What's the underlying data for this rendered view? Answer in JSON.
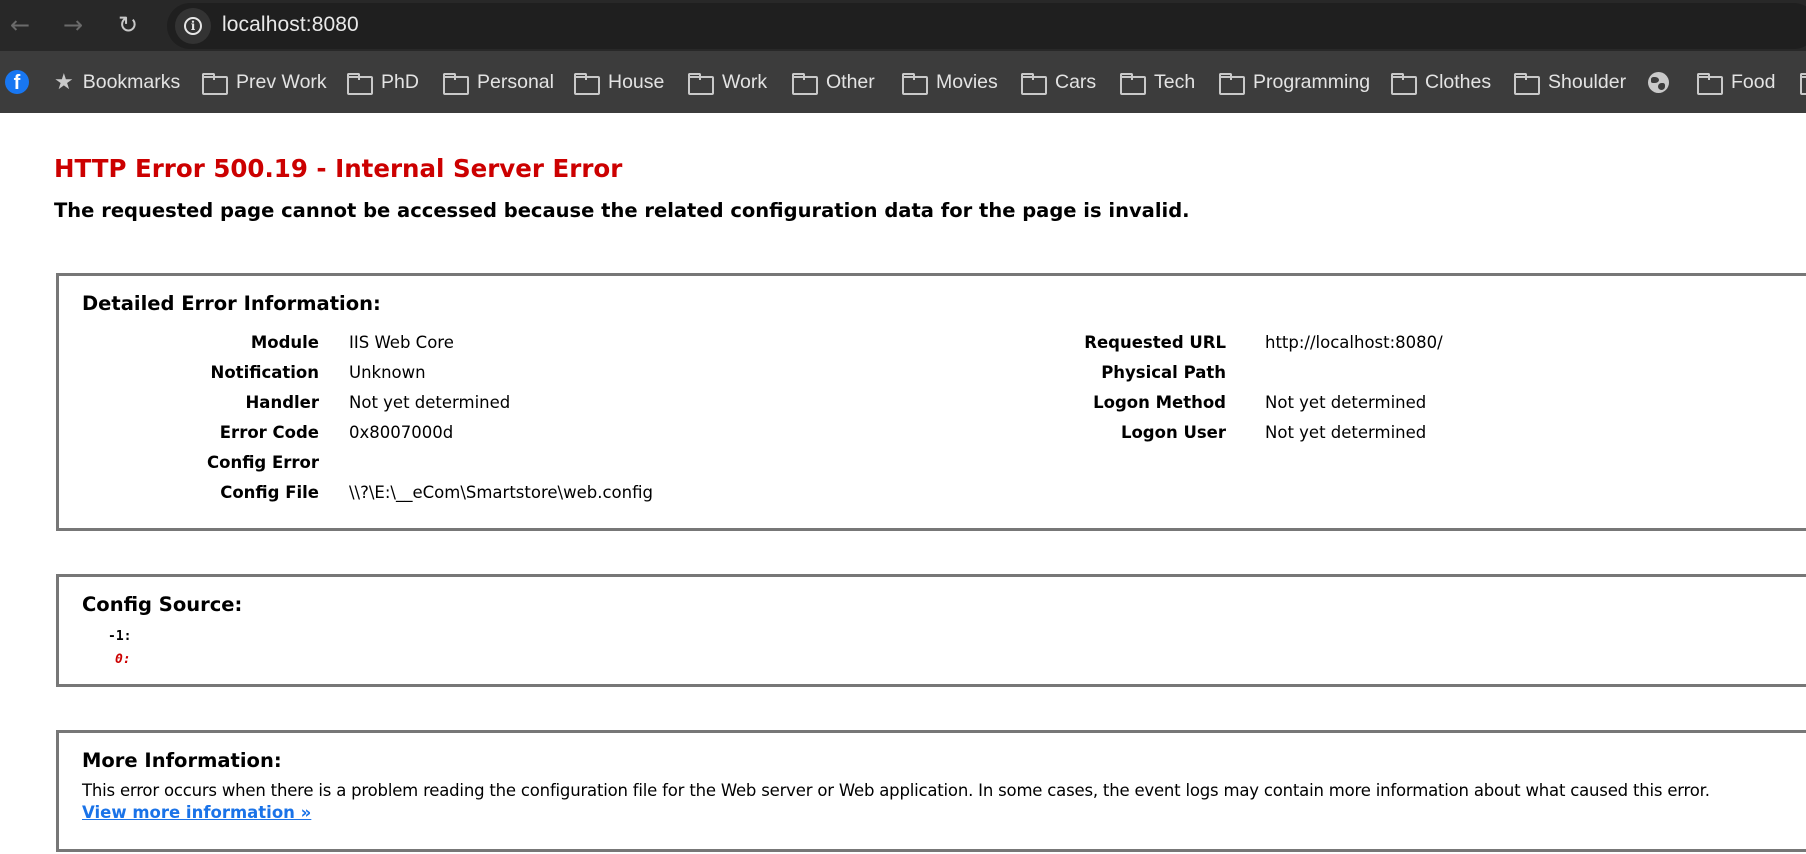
{
  "browser": {
    "url": "localhost:8080",
    "nav": {
      "back_icon": "arrow-left-icon",
      "forward_icon": "arrow-right-icon",
      "reload_icon": "reload-icon",
      "site_info_icon": "info-icon"
    },
    "bookmarks": [
      {
        "type": "site",
        "icon": "facebook-icon",
        "label": ""
      },
      {
        "type": "bookmarks",
        "icon": "star-icon",
        "label": "Bookmarks"
      },
      {
        "type": "folder",
        "icon": "folder-icon",
        "label": "Prev Work"
      },
      {
        "type": "folder",
        "icon": "folder-icon",
        "label": "PhD"
      },
      {
        "type": "folder",
        "icon": "folder-icon",
        "label": "Personal"
      },
      {
        "type": "folder",
        "icon": "folder-icon",
        "label": "House"
      },
      {
        "type": "folder",
        "icon": "folder-icon",
        "label": "Work"
      },
      {
        "type": "folder",
        "icon": "folder-icon",
        "label": "Other"
      },
      {
        "type": "folder",
        "icon": "folder-icon",
        "label": "Movies"
      },
      {
        "type": "folder",
        "icon": "folder-icon",
        "label": "Cars"
      },
      {
        "type": "folder",
        "icon": "folder-icon",
        "label": "Tech"
      },
      {
        "type": "folder",
        "icon": "folder-icon",
        "label": "Programming"
      },
      {
        "type": "folder",
        "icon": "folder-icon",
        "label": "Clothes"
      },
      {
        "type": "folder",
        "icon": "folder-icon",
        "label": "Shoulder"
      },
      {
        "type": "site",
        "icon": "globe-icon",
        "label": ""
      },
      {
        "type": "folder",
        "icon": "folder-icon",
        "label": "Food"
      },
      {
        "type": "folder",
        "icon": "folder-icon",
        "label": ""
      }
    ]
  },
  "page": {
    "title": "HTTP Error 500.19 - Internal Server Error",
    "subtitle": "The requested page cannot be accessed because the related configuration data for the page is invalid.",
    "detail": {
      "heading": "Detailed Error Information:",
      "left": [
        {
          "key": "Module",
          "value": "IIS Web Core"
        },
        {
          "key": "Notification",
          "value": "Unknown"
        },
        {
          "key": "Handler",
          "value": "Not yet determined"
        },
        {
          "key": "Error Code",
          "value": "0x8007000d"
        },
        {
          "key": "Config Error",
          "value": ""
        },
        {
          "key": "Config File",
          "value": "\\\\?\\E:\\__eCom\\Smartstore\\web.config"
        }
      ],
      "right": [
        {
          "key": "Requested URL",
          "value": "http://localhost:8080/"
        },
        {
          "key": "Physical Path",
          "value": ""
        },
        {
          "key": "Logon Method",
          "value": "Not yet determined"
        },
        {
          "key": "Logon User",
          "value": "Not yet determined"
        }
      ]
    },
    "config_source": {
      "heading": "Config Source:",
      "lines": [
        {
          "number": "-1:",
          "text": ""
        },
        {
          "number": "0:",
          "text": ""
        }
      ]
    },
    "more_info": {
      "heading": "More Information:",
      "text": "This error occurs when there is a problem reading the configuration file for the Web server or Web application. In some cases, the event logs may contain more information about what caused this error.",
      "link_label": "View more information »"
    }
  },
  "colors": {
    "error_red": "#cc0000",
    "link_blue": "#1a73e8",
    "box_border": "#777777",
    "toolbar_bg": "#282828",
    "bookmarks_bg": "#3c3c3c"
  }
}
